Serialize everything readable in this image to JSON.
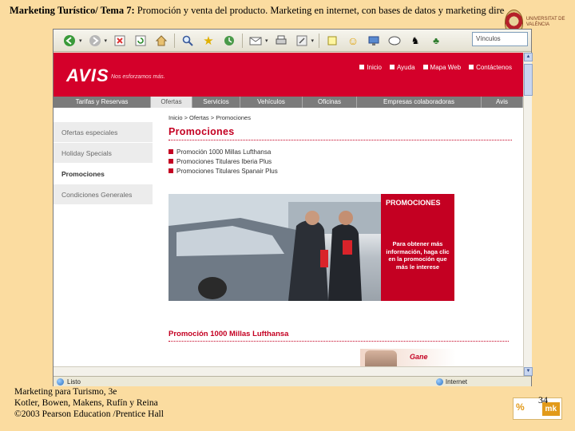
{
  "slide": {
    "title_bold": "Marketing Turístico/ Tema 7:",
    "title_rest": " Promoción y venta del producto. Marketing en internet, con bases de datos y marketing directo",
    "footer_line1": "Marketing para Turismo, 3e",
    "footer_line2": "Kotler, Bowen, Makens, Rufín y Reina",
    "footer_line3": "©2003 Pearson Education /Prentice Hall",
    "page_number": "34",
    "mk_logo_text": "mk",
    "mk_logo_symbol": "%",
    "uni_logo_text": "UNIVERSITAT DE VALÈNCIA"
  },
  "browser": {
    "address_partial": "Vínculos",
    "status_left": "Listo",
    "status_zone": "Internet",
    "toolbar_icons": [
      "back-icon",
      "forward-icon",
      "stop-icon",
      "refresh-icon",
      "home-icon",
      "search-icon",
      "favorites-icon",
      "history-icon",
      "mail-icon",
      "print-icon",
      "edit-icon",
      "discuss-icon",
      "messenger-icon",
      "smiley-icon",
      "desktop-icon",
      "msn-icon",
      "aim-icon",
      "people-icon"
    ]
  },
  "site": {
    "logo": "AVIS",
    "tagline": "Nos esforzamos más.",
    "top_links": [
      "Inicio",
      "Ayuda",
      "Mapa Web",
      "Contáctenos"
    ],
    "nav_tabs": [
      "Tarifas y Reservas",
      "Ofertas",
      "Servicios",
      "Vehículos",
      "Oficinas",
      "Empresas colaboradoras",
      "Avis"
    ],
    "side_items": [
      "Ofertas especiales",
      "Holiday Specials",
      "Promociones",
      "Condiciones Generales"
    ],
    "breadcrumb": "Inicio  >  Ofertas  >  Promociones",
    "page_heading": "Promociones",
    "promo_items": [
      "Promoción 1000 Millas Lufthansa",
      "Promociones Titulares Iberia Plus",
      "Promociones Titulares Spanair Plus"
    ],
    "promo_box_head": "PROMOCIONES",
    "promo_box_text": "Para obtener más información, haga clic en la promoción que más le interese",
    "section_title": "Promoción 1000 Millas Lufthansa",
    "gane_text": "Gane"
  },
  "colors": {
    "avis_red": "#d4002a",
    "slide_bg": "#fbdca0"
  }
}
